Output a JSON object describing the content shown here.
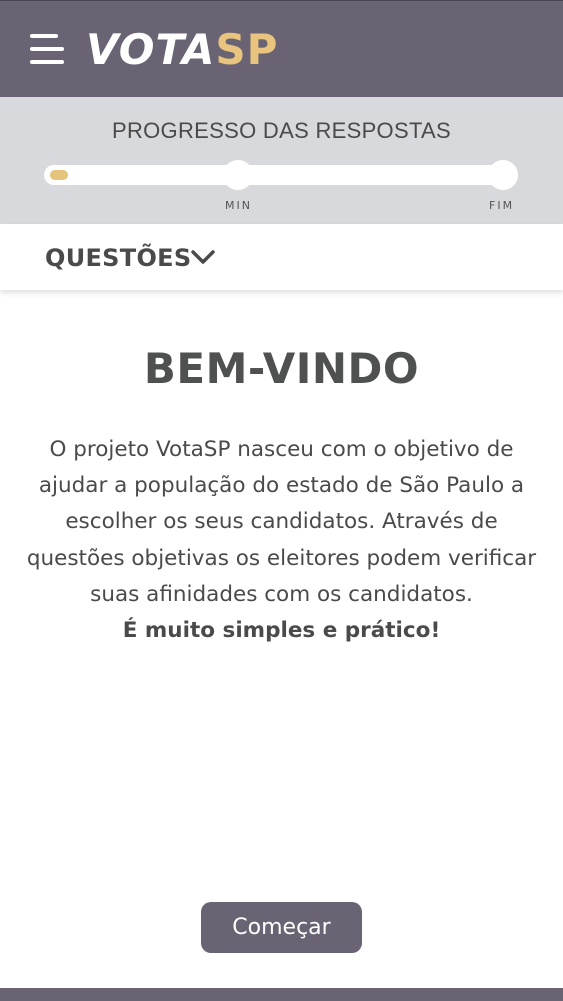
{
  "header": {
    "logo_part1": "VOTA",
    "logo_part2": "SP",
    "menu_icon": "hamburger-menu-icon",
    "background_color": "#6a6373",
    "accent_color": "#e8c47e"
  },
  "progress": {
    "title": "PROGRESSO DAS RESPOSTAS",
    "value_fraction": 0.03,
    "milestones": [
      "MIN",
      "FIM"
    ],
    "fill_color": "#e4c37b"
  },
  "questions": {
    "label": "QUESTÕES",
    "toggle_icon": "chevron-down-icon"
  },
  "welcome": {
    "title": "BEM-VINDO",
    "body": "O projeto VotaSP nasceu com o objetivo de ajudar a população do estado de São Paulo a escolher os seus candidatos. Através de questões objetivas os eleitores podem verificar suas afinidades com os candidatos.",
    "emphasis": "É muito simples e prático!"
  },
  "actions": {
    "start_label": "Começar"
  }
}
